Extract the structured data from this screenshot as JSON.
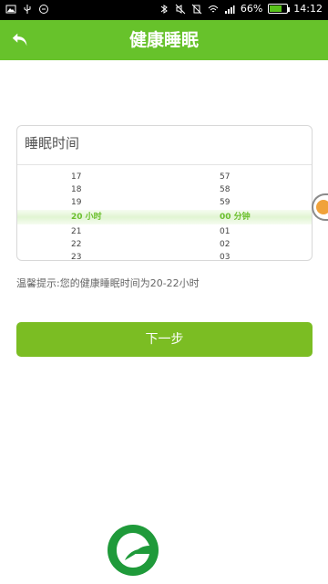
{
  "statusbar": {
    "battery_percent": "66%",
    "time": "14:12"
  },
  "header": {
    "title": "健康睡眠"
  },
  "form": {
    "label": "睡眠时间",
    "hours": [
      "17",
      "18",
      "19",
      "20 小时",
      "21",
      "22",
      "23"
    ],
    "minutes": [
      "57",
      "58",
      "59",
      "00 分钟",
      "01",
      "02",
      "03"
    ]
  },
  "tip": "温馨提示:您的健康睡眠时间为20-22小时",
  "next_label": "下一步",
  "colors": {
    "primary": "#67c22b",
    "button": "#7bbd23",
    "selected_text": "#6bbf2d"
  },
  "icons": {
    "back": "back-arrow-icon",
    "logo": "leaf-logo-icon"
  }
}
